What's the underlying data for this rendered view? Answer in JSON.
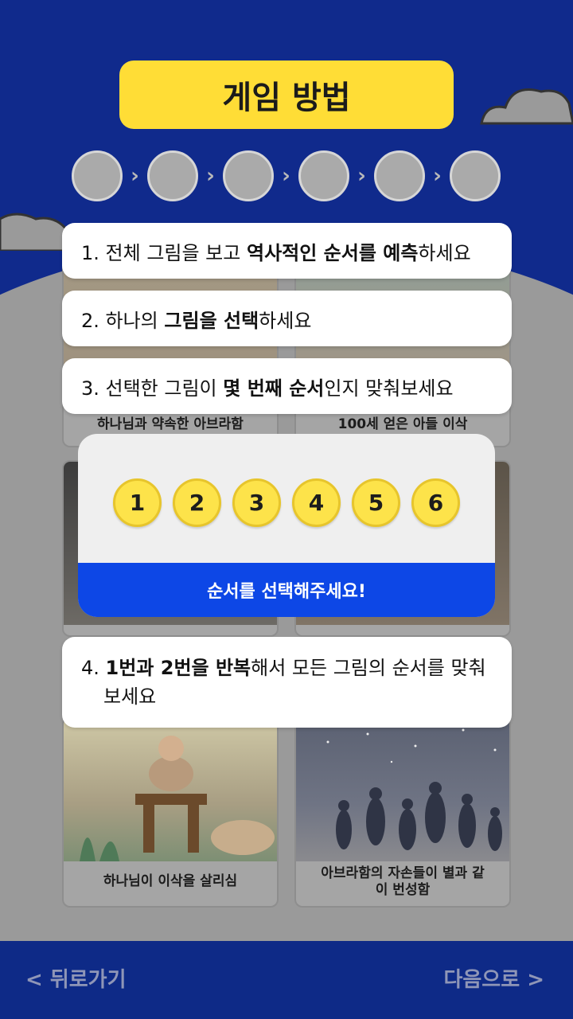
{
  "title": "게임 방법",
  "instructions": {
    "step1": {
      "prefix": "1. 전체 그림을 보고 ",
      "bold": "역사적인 순서를 예측",
      "suffix": "하세요"
    },
    "step2": {
      "prefix": "2. 하나의 ",
      "bold": "그림을 선택",
      "suffix": "하세요"
    },
    "step3": {
      "prefix": "3. 선택한 그림이 ",
      "bold": "몇 번째 순서",
      "suffix": "인지 맞춰보세요"
    },
    "step4": {
      "prefix": "4. ",
      "bold1": "1번과 2번을 반복",
      "suffix_line1": "해서 모든 그림의 순서를 맞춰",
      "line2": "보세요"
    }
  },
  "cards": [
    {
      "caption": "하나님과 약속한 아브라함"
    },
    {
      "caption": "100세 얻은 아들 이삭"
    },
    {
      "caption": ""
    },
    {
      "caption": ""
    },
    {
      "caption": "하나님이 이삭을 살리심"
    },
    {
      "caption": "아브라함의 자손들이 별과 같이 번성함"
    }
  ],
  "modal": {
    "numbers": [
      "1",
      "2",
      "3",
      "4",
      "5",
      "6"
    ],
    "prompt": "순서를 선택해주세요!"
  },
  "footer": {
    "back_label": "< 뒤로가기",
    "next_label": "다음으로 >"
  },
  "colors": {
    "navy": "#102a8c",
    "yellow": "#ffdd36",
    "accent_blue": "#0d47e6"
  }
}
